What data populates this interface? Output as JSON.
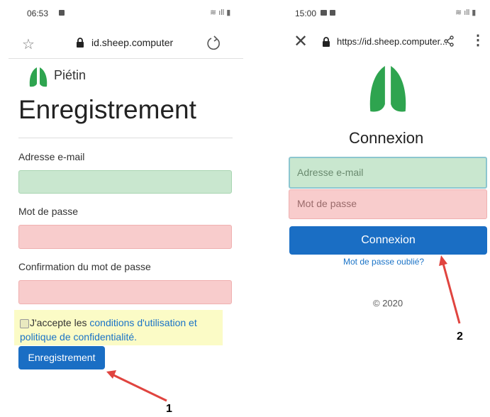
{
  "left": {
    "status_time": "06:53",
    "url": "id.sheep.computer",
    "brand": "Piétin",
    "title": "Enregistrement",
    "email_label": "Adresse e-mail",
    "password_label": "Mot de passe",
    "confirm_label": "Confirmation du mot de passe",
    "terms_prefix": "J'accepte les",
    "terms_link_1": "conditions d'utilisation et",
    "terms_link_2": "politique de confidentialité.",
    "submit_label": "Enregistrement",
    "annotation": "1"
  },
  "right": {
    "status_time": "15:00",
    "url": "https://id.sheep.computer...",
    "title": "Connexion",
    "email_placeholder": "Adresse e-mail",
    "password_placeholder": "Mot de passe",
    "submit_label": "Connexion",
    "forgot_label": "Mot de passe oublié?",
    "copyright": "© 2020",
    "annotation": "2"
  },
  "colors": {
    "brand_green": "#2ea44f",
    "button_blue": "#1a6ec4",
    "arrow_red": "#e0443f"
  }
}
